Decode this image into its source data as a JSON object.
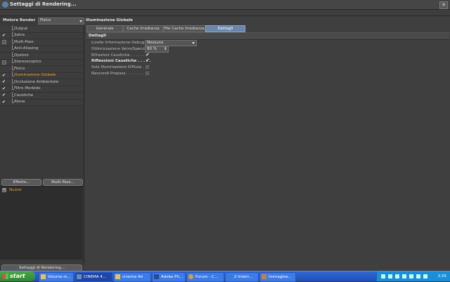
{
  "window": {
    "title": "Settaggi di Rendering..."
  },
  "left": {
    "engine_label": "Motore Render",
    "engine_value": "Fisico",
    "tree": [
      {
        "label": "Output",
        "check": ""
      },
      {
        "label": "Salva",
        "check": "✔"
      },
      {
        "label": "Multi-Pass",
        "check": "box"
      },
      {
        "label": "Anti-Aliasing",
        "check": ""
      },
      {
        "label": "Opzioni",
        "check": ""
      },
      {
        "label": "Stereoscopico",
        "check": "box"
      },
      {
        "label": "Fisico",
        "check": ""
      },
      {
        "label": "Illuminazione Globale",
        "check": "✔",
        "active": true
      },
      {
        "label": "Occlusione Ambientale",
        "check": "✔"
      },
      {
        "label": "Filtro Morbido",
        "check": "✔"
      },
      {
        "label": "Caustiche",
        "check": "✔"
      },
      {
        "label": "Alone",
        "check": "✔"
      }
    ],
    "effect_button": "Effetto...",
    "multipass_button": "Multi-Pass...",
    "effect_item": "Nuovo",
    "render_settings_button": "Settaggi di Rendering..."
  },
  "right": {
    "section_title": "Illuminazione Globale",
    "tabs": [
      "Generale",
      "Cache Irradianza",
      "File Cache Irradianza",
      "Dettagli"
    ],
    "selected_tab": "Dettagli",
    "subheader": "Dettagli",
    "props": {
      "debug_label": "Livello Informazione Debug . . .",
      "debug_value": "Nessuno",
      "glass_label": "Ottimizzazione Vetro/Specchio",
      "glass_value": "80 %",
      "refr_label": "Rifrazioni Caustiche . . . . . .",
      "refl_label": "Riflessioni Caustiche . . . . .",
      "diffuse_label": "Solo Illuminazione Diffusa . .",
      "hide_label": "Nascondi Prepass. . . . . . . ."
    }
  },
  "taskbar": {
    "start": "start",
    "items": [
      {
        "label": "Volume m..."
      },
      {
        "label": "CINEMA 4..."
      },
      {
        "label": "cinema 4d"
      },
      {
        "label": "Adobe Ph..."
      },
      {
        "label": "Forum - C..."
      },
      {
        "label": "2 Intern..."
      },
      {
        "label": "Immagine..."
      }
    ],
    "clock": "2.55"
  }
}
